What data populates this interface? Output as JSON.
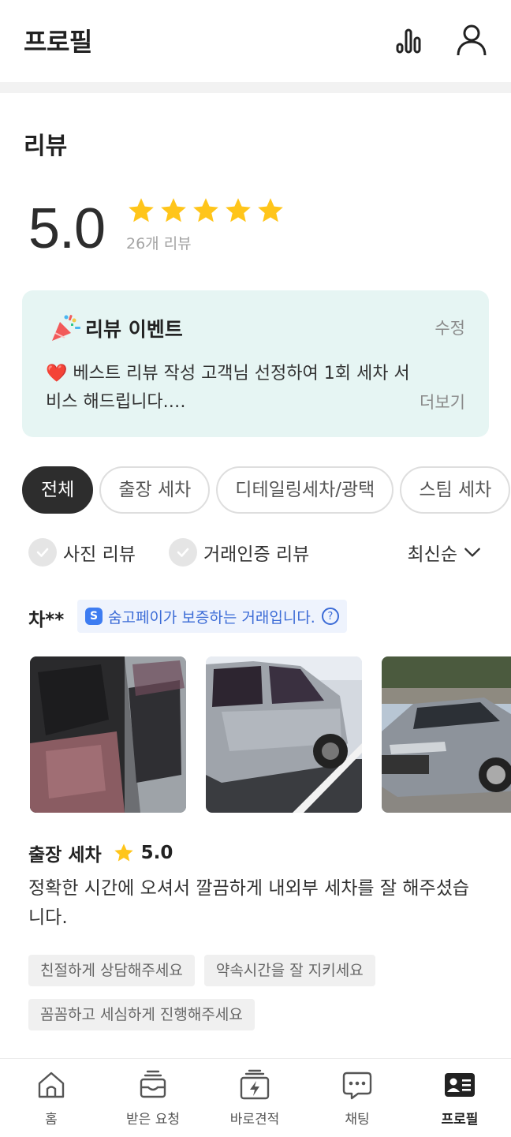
{
  "header": {
    "title": "프로필",
    "icons": [
      "bar-chart-icon",
      "user-icon"
    ]
  },
  "reviews": {
    "section_title": "리뷰",
    "rating": "5.0",
    "star_count": 5,
    "review_count": "26개 리뷰"
  },
  "event": {
    "title": "리뷰 이벤트",
    "edit_label": "수정",
    "heart": "❤️",
    "text": "베스트 리뷰 작성 고객님 선정하여 1회 세차 서비스 해드립니다.…",
    "more_label": "더보기"
  },
  "category_chips": [
    {
      "label": "전체",
      "active": true
    },
    {
      "label": "출장 세차",
      "active": false
    },
    {
      "label": "디테일링세차/광택",
      "active": false
    },
    {
      "label": "스팀 세차",
      "active": false
    }
  ],
  "filters": {
    "photo_review": "사진 리뷰",
    "verified_review": "거래인증 리뷰",
    "sort": "최신순"
  },
  "review": {
    "reviewer": "차**",
    "pay_badge": "숨고페이가 보증하는 거래입니다.",
    "pay_badge_icon": "S",
    "help_icon": "?",
    "service": "출장 세차",
    "score": "5.0",
    "text": "정확한 시간에 오셔서 깔끔하게 내외부 세차를 잘 해주셨습니다.",
    "tags": [
      "친절하게 상담해주세요",
      "약속시간을 잘 지키세요",
      "꼼꼼하고 세심하게 진행해주세요"
    ]
  },
  "bottom_nav": [
    {
      "label": "홈",
      "icon": "home-icon",
      "active": false
    },
    {
      "label": "받은 요청",
      "icon": "inbox-icon",
      "active": false
    },
    {
      "label": "바로견적",
      "icon": "quick-quote-icon",
      "active": false
    },
    {
      "label": "채팅",
      "icon": "chat-icon",
      "active": false
    },
    {
      "label": "프로필",
      "icon": "profile-card-icon",
      "active": true
    }
  ],
  "colors": {
    "star": "#FFC51A",
    "accent_bg": "#E6F5F3",
    "pay_blue": "#3B6BD6",
    "dark": "#2D2D2D"
  }
}
